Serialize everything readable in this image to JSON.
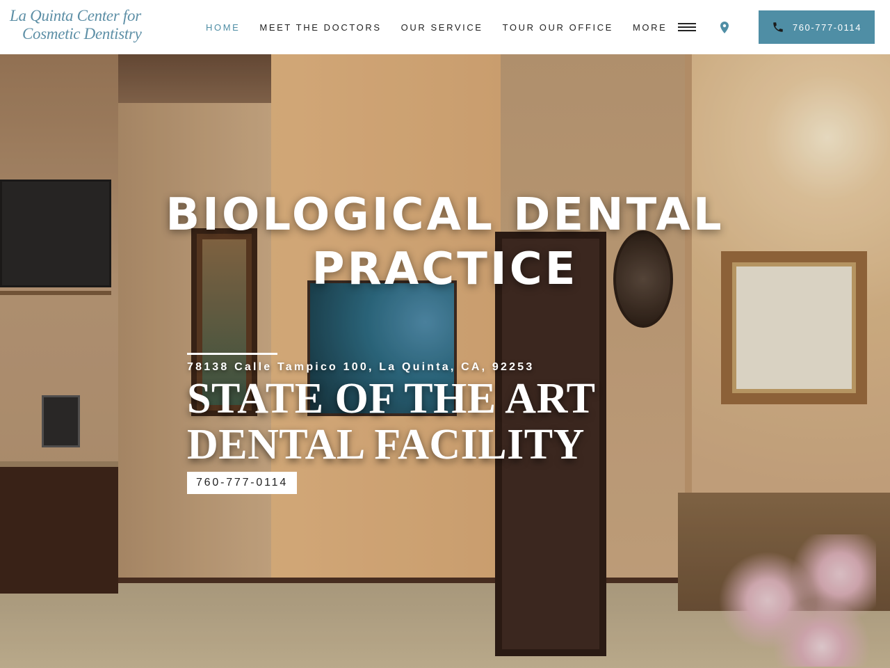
{
  "logo": {
    "line1": "La Quinta Center for",
    "line2": "Cosmetic Dentistry"
  },
  "nav": {
    "items": [
      {
        "label": "HOME",
        "active": true
      },
      {
        "label": "MEET THE DOCTORS"
      },
      {
        "label": "OUR SERVICE"
      },
      {
        "label": "TOUR OUR OFFICE"
      }
    ],
    "more_label": "MORE"
  },
  "header": {
    "phone": "760-777-0114",
    "accent_color": "#4f8ea5"
  },
  "hero": {
    "headline_line1": "BIOLOGICAL DENTAL",
    "headline_line2": "PRACTICE",
    "address": "78138 Calle Tampico 100, La Quinta, CA, 92253",
    "subhead_line1": "STATE OF THE ART",
    "subhead_line2": "DENTAL FACILITY",
    "cta_phone": "760-777-0114"
  },
  "icons": [
    "map-pin-icon",
    "phone-icon",
    "hamburger-menu-icon"
  ]
}
